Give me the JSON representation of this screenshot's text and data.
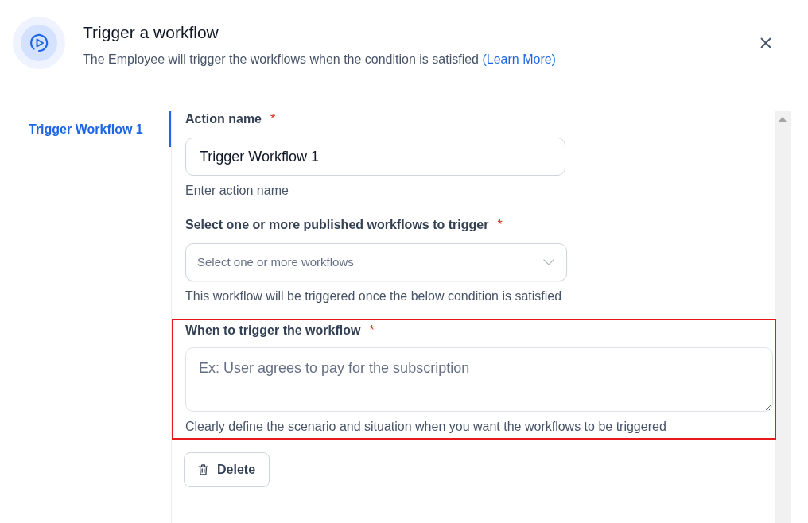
{
  "header": {
    "title": "Trigger a workflow",
    "description": "The Employee will trigger the workflows when the condition is satisfied",
    "link": "(Learn More)"
  },
  "sidebar": {
    "items": [
      {
        "label": "Trigger Workflow 1",
        "selected": true
      }
    ]
  },
  "form": {
    "fields": [
      {
        "kind": "input",
        "label": "Action name",
        "required_mark": "*",
        "value": "Trigger Workflow 1",
        "help": "Enter action name",
        "highlighted": false
      },
      {
        "kind": "select",
        "label": "Select one or more published workflows to trigger",
        "required_mark": "*",
        "placeholder": "Select one or more workflows",
        "help": "This workflow will be triggered once the below condition is satisfied",
        "highlighted": false
      },
      {
        "kind": "textarea",
        "label": "When to trigger the workflow",
        "required_mark": "*",
        "placeholder": "Ex: User agrees to pay for the subscription",
        "help": "Clearly define the scenario and situation when you want the workflows to be triggered",
        "highlighted": true
      }
    ],
    "delete_button": {
      "label": "Delete"
    }
  }
}
